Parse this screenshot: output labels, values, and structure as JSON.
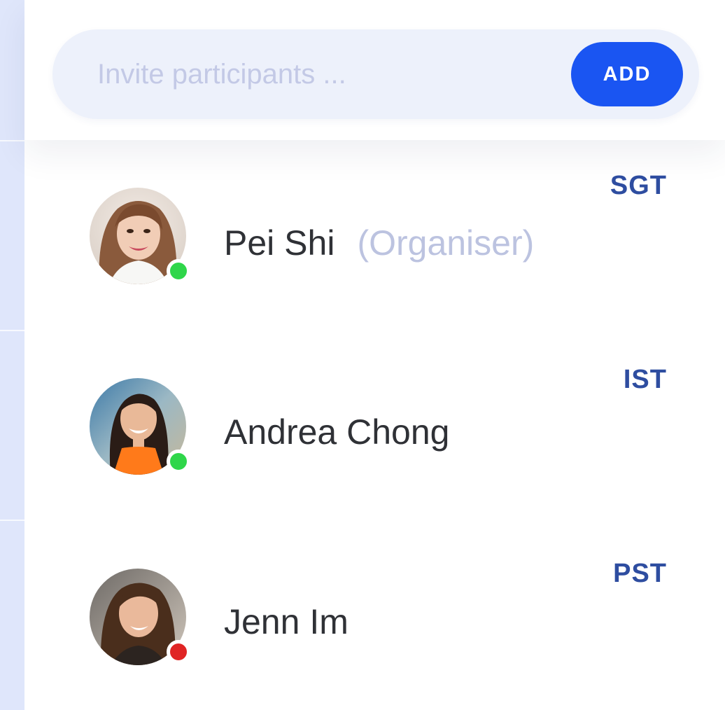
{
  "invite": {
    "placeholder": "Invite participants ...",
    "value": "",
    "add_label": "ADD"
  },
  "participants": [
    {
      "name": "Pei Shi",
      "role": "(Organiser)",
      "timezone": "SGT",
      "status": "online",
      "status_color": "#2fd64a"
    },
    {
      "name": "Andrea Chong",
      "role": "",
      "timezone": "IST",
      "status": "online",
      "status_color": "#2fd64a"
    },
    {
      "name": "Jenn Im",
      "role": "",
      "timezone": "PST",
      "status": "offline",
      "status_color": "#e02424"
    }
  ],
  "colors": {
    "accent": "#1a55f2",
    "timezone_text": "#2e4da0",
    "online": "#2fd64a",
    "offline": "#e02424",
    "role_text": "#bcc3e0"
  }
}
